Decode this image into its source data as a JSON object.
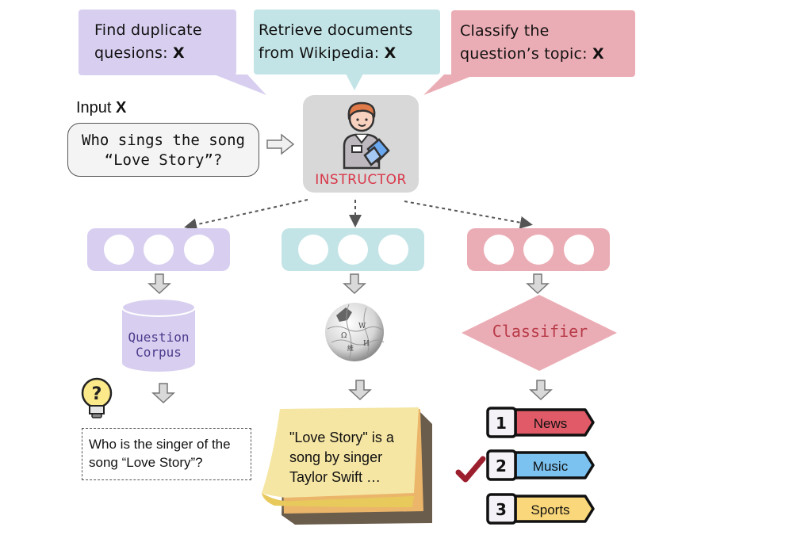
{
  "prompts": [
    {
      "line1": "Find duplicate",
      "line2": "quesions: ",
      "var": "X",
      "color": "#d8cff0"
    },
    {
      "line1": "Retrieve documents",
      "line2": "from Wikipedia: ",
      "var": "X",
      "color": "#c3e4e6"
    },
    {
      "line1": "Classify the",
      "line2": "question’s topic: ",
      "var": "X",
      "color": "#ebadb5"
    }
  ],
  "input": {
    "label": "Input ",
    "var": "X",
    "line1": "Who sings the song",
    "line2": "“Love Story”?"
  },
  "instructor": {
    "label": "INSTRUCTOR"
  },
  "branches": {
    "retrieval": {
      "store_line1": "Question",
      "store_line2": "Corpus",
      "result_line1": "Who is the singer of the",
      "result_line2": "song “Love Story”?"
    },
    "wikipedia": {
      "result_line1": "\"Love Story\" is a",
      "result_line2": "song by singer",
      "result_line3": "Taylor Swift …"
    },
    "classification": {
      "model_label": "Classifier",
      "options": [
        {
          "rank": "1",
          "label": "News",
          "color": "#e05a67",
          "selected": false
        },
        {
          "rank": "2",
          "label": "Music",
          "color": "#7cc2f0",
          "selected": true
        },
        {
          "rank": "3",
          "label": "Sports",
          "color": "#fad77a",
          "selected": false
        }
      ]
    }
  },
  "colors": {
    "purple": "#d8cff0",
    "teal": "#c3e4e6",
    "pink": "#ebadb5",
    "instructor_bg": "#d8d8d8",
    "instructor_text": "#d9384a",
    "check": "#9c1f2e"
  }
}
